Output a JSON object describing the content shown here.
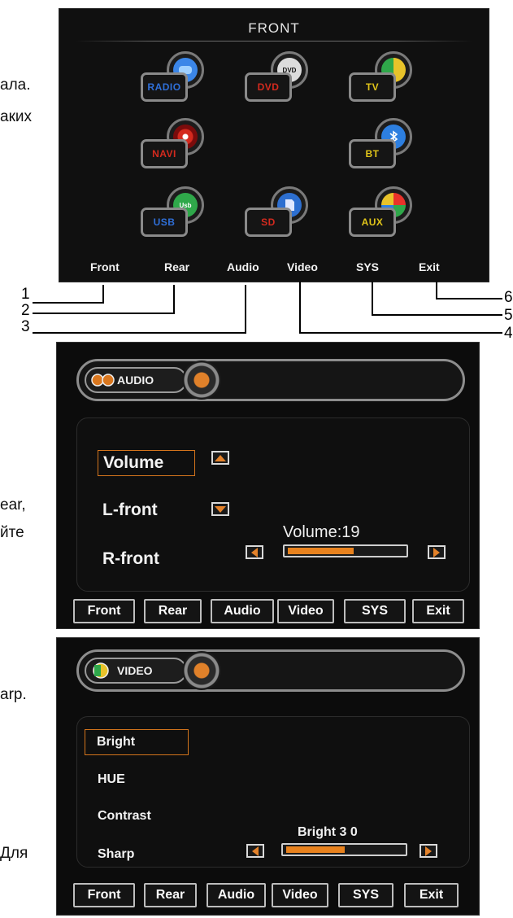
{
  "side_text": {
    "line1": "ала.",
    "line2": "аких",
    "line3": "ear,",
    "line4": "йте",
    "line5": "arp.",
    "line6": "Для"
  },
  "front_menu": {
    "title": "FRONT",
    "tiles": [
      {
        "label": "RADIO",
        "color": "#2f6fd8"
      },
      {
        "label": "DVD",
        "color": "#d42a1e"
      },
      {
        "label": "TV",
        "color": "#e0c419"
      },
      {
        "label": "NAVI",
        "color": "#d42a1e"
      },
      {
        "label": "BT",
        "color": "#e0c419"
      },
      {
        "label": "USB",
        "color": "#2f6fd8"
      },
      {
        "label": "SD",
        "color": "#d42a1e"
      },
      {
        "label": "AUX",
        "color": "#e0c419"
      }
    ],
    "nav": [
      "Front",
      "Rear",
      "Audio",
      "Video",
      "SYS",
      "Exit"
    ]
  },
  "callouts": [
    "1",
    "2",
    "3",
    "4",
    "5",
    "6"
  ],
  "audio_panel": {
    "header": "AUDIO",
    "items": [
      "Volume",
      "L-front",
      "R-front"
    ],
    "selected": "Volume",
    "slider_label": "Volume:19",
    "slider_fraction": 0.57,
    "bottom": [
      "Front",
      "Rear",
      "Audio",
      "Video",
      "SYS",
      "Exit"
    ]
  },
  "video_panel": {
    "header": "VIDEO",
    "items": [
      "Bright",
      "HUE",
      "Contrast",
      "Sharp"
    ],
    "selected": "Bright",
    "slider_label": "Bright 3 0",
    "slider_fraction": 0.5,
    "bottom": [
      "Front",
      "Rear",
      "Audio",
      "Video",
      "SYS",
      "Exit"
    ]
  },
  "colors": {
    "accent": "#e8821e"
  }
}
